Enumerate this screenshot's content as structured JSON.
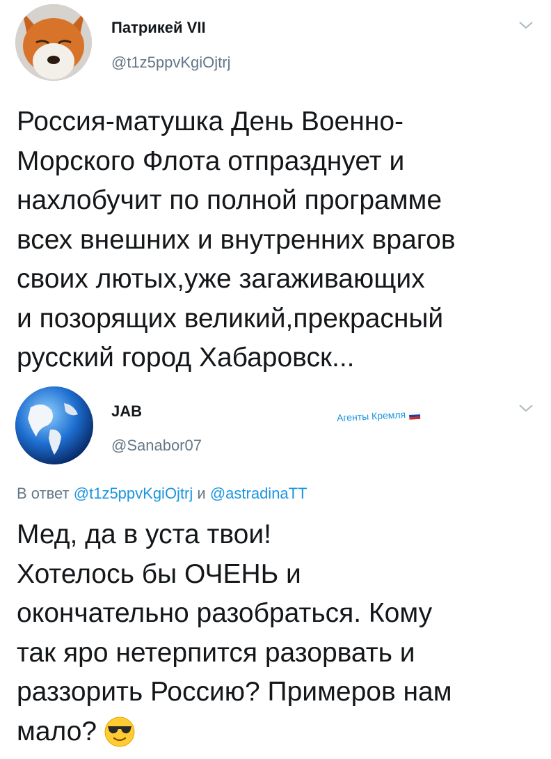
{
  "tweet1": {
    "author_name": "Патрикей VII",
    "author_handle": "@t1z5ppvKgiOjtrj",
    "text_lines": [
      "Россия-матушка День Военно-",
      "Морского Флота отпразднует и",
      "нахлобучит по полной программе",
      "всех внешних и внутренних врагов",
      "своих лютых,уже загаживающих",
      "и позорящих великий,прекрасный",
      "русский город Хабаровск..."
    ]
  },
  "tweet2": {
    "author_name": "JAB",
    "author_handle": "@Sanabor07",
    "label": "Агенты Кремля",
    "reply_prefix": "В ответ",
    "reply_mention_1": "@t1z5ppvKgiOjtrj",
    "reply_conj": "и",
    "reply_mention_2": "@astradinaTT",
    "text_lines": [
      "Мед, да в уста твои!",
      "Хотелось бы ОЧЕНЬ и",
      "окончательно разобраться. Кому",
      "так яро нетерпится разорвать и",
      "раззорить Россию? Примеров нам",
      "мало?"
    ],
    "emoji": "smiling-face-with-sunglasses"
  },
  "colors": {
    "link": "#1b95e0",
    "secondary_text": "#657786",
    "chevron": "#aab8c2"
  }
}
